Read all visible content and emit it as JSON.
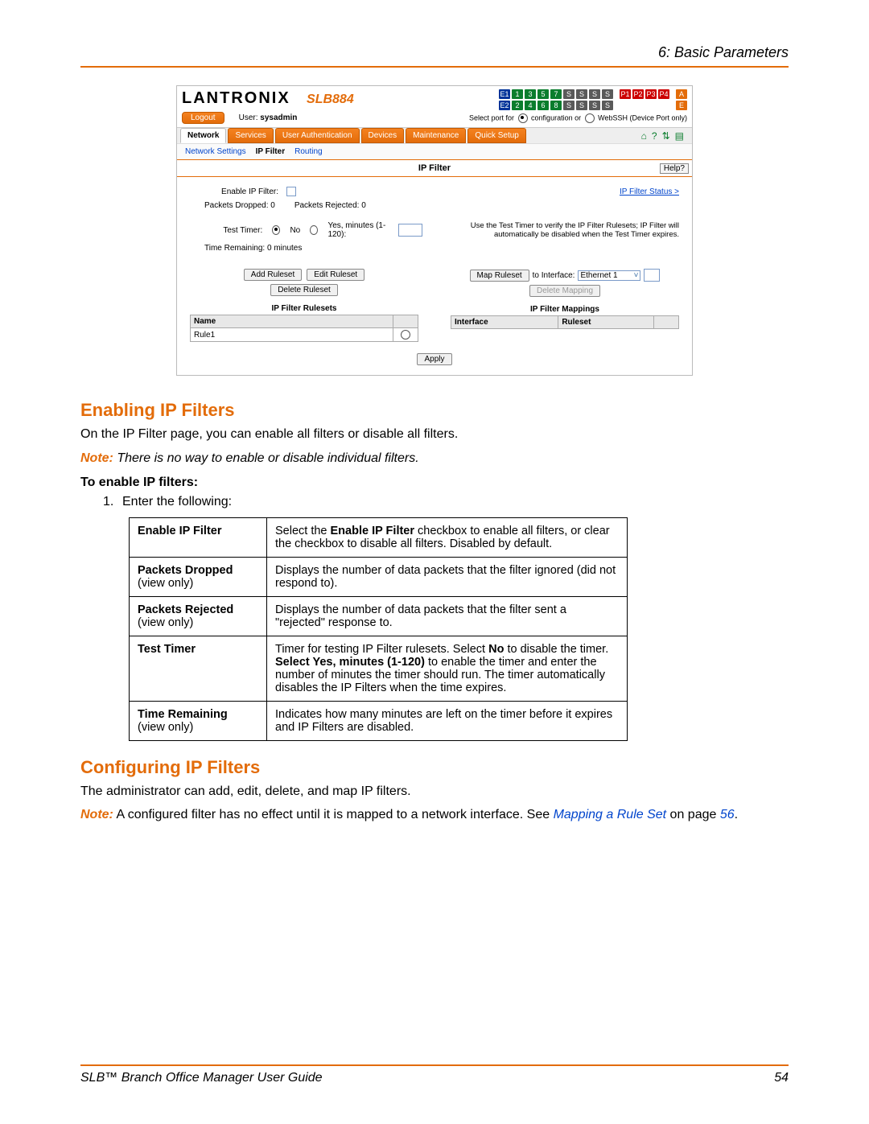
{
  "chapter": "6: Basic Parameters",
  "screenshot": {
    "brand": "LANTRONIX",
    "model": "SLB884",
    "logout": "Logout",
    "user_label": "User:",
    "user_value": "sysadmin",
    "port_select_text": "Select port for",
    "config_label": "configuration or",
    "webssh_label": "WebSSH (Device Port only)",
    "ports_e": [
      "E1",
      "E2"
    ],
    "ports_nums": [
      "1",
      "2",
      "3",
      "4",
      "5",
      "6",
      "7",
      "8"
    ],
    "ports_s": [
      "S",
      "S",
      "S",
      "S",
      "S",
      "S",
      "S",
      "S"
    ],
    "ports_p": [
      "P1",
      "P2",
      "P3",
      "P4"
    ],
    "ports_ae": [
      "A",
      "E"
    ],
    "tabs": [
      "Network",
      "Services",
      "User Authentication",
      "Devices",
      "Maintenance",
      "Quick Setup"
    ],
    "subtabs": [
      "Network Settings",
      "IP Filter",
      "Routing"
    ],
    "page_title": "IP Filter",
    "help": "Help?",
    "enable_label": "Enable IP Filter:",
    "packets_dropped": "Packets Dropped: 0",
    "packets_rejected": "Packets Rejected: 0",
    "status_link": "IP Filter Status >",
    "test_timer_label": "Test Timer:",
    "tt_no": "No",
    "tt_yes": "Yes, minutes (1-120):",
    "tt_help": "Use the Test Timer to verify the IP Filter Rulesets; IP Filter will automatically be disabled when the Test Timer expires.",
    "time_remaining": "Time Remaining: 0 minutes",
    "btn_add": "Add Ruleset",
    "btn_edit": "Edit Ruleset",
    "btn_delete": "Delete Ruleset",
    "btn_map": "Map Ruleset",
    "to_interface": "to Interface:",
    "iface_value": "Ethernet 1",
    "btn_delmap": "Delete Mapping",
    "rulesets_title": "IP Filter Rulesets",
    "mappings_title": "IP Filter Mappings",
    "col_name": "Name",
    "col_iface": "Interface",
    "col_ruleset": "Ruleset",
    "rule1": "Rule1",
    "apply": "Apply"
  },
  "sec1": {
    "title": "Enabling IP Filters",
    "p1": "On the IP Filter page, you can enable all filters or disable all filters.",
    "note_label": "Note:",
    "note_body": "There is no way to enable or disable individual filters.",
    "subhead": "To enable IP filters:",
    "step_num": "1.",
    "step_text": "Enter the following:"
  },
  "table": {
    "r1k": "Enable IP Filter",
    "r1v_a": "Select the ",
    "r1v_b": "Enable IP Filter",
    "r1v_c": " checkbox to enable all filters, or clear the checkbox to disable all filters. Disabled by default.",
    "r2k": "Packets Dropped",
    "r2k2": "(view only)",
    "r2v": "Displays the number of data packets that the filter ignored (did not respond to).",
    "r3k": "Packets Rejected",
    "r3k2": "(view only)",
    "r3v": "Displays the number of data packets that the filter sent a \"rejected\" response to.",
    "r4k": "Test Timer",
    "r4v_a": "Timer for testing IP Filter rulesets. Select ",
    "r4v_b": "No",
    "r4v_c": " to disable the timer. ",
    "r4v_d": "Select Yes, minutes (1-120)",
    "r4v_e": " to enable the timer and enter the number of minutes the timer should run. The timer automatically disables the IP Filters when the time expires.",
    "r5k": "Time Remaining",
    "r5k2": "(view only)",
    "r5v": "Indicates how many minutes are left on the timer before it expires and IP Filters are disabled."
  },
  "sec2": {
    "title": "Configuring IP Filters",
    "p1": "The administrator can add, edit, delete, and map IP filters.",
    "note_label": "Note:",
    "note_body_a": " A configured filter has no effect until it is mapped to a network interface. See ",
    "note_link": "Mapping a Rule Set",
    "note_body_b": " on page ",
    "note_page": "56",
    "note_period": "."
  },
  "footer": {
    "title": "SLB™ Branch Office Manager User Guide",
    "page": "54"
  }
}
